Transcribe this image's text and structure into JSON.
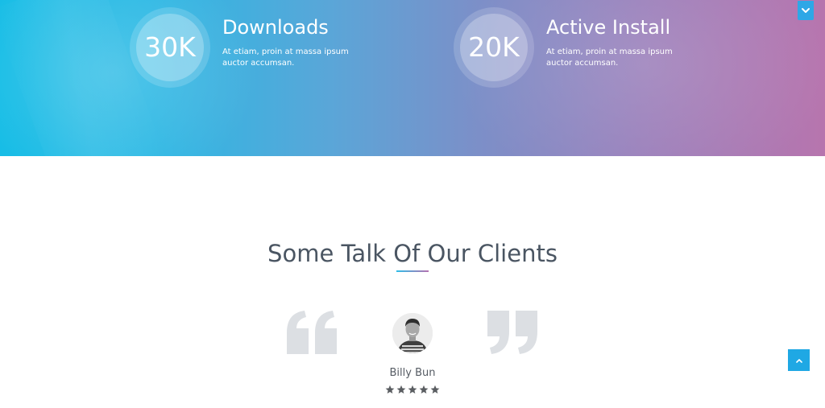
{
  "stats": [
    {
      "value": "30K",
      "title": "Downloads",
      "description": "At etiam, proin at massa ipsum auctor accumsan."
    },
    {
      "value": "20K",
      "title": "Active Install",
      "description": "At etiam, proin at massa ipsum auctor accumsan."
    }
  ],
  "testimonials": {
    "heading": "Some Talk Of Our Clients",
    "client_name": "Billy Bun",
    "rating": 5,
    "quote_color": "#dcdfe3"
  },
  "controls": {
    "dropdown_icon": "chevron-down-icon",
    "scroll_top_icon": "chevron-up-icon"
  },
  "colors": {
    "gradient_start": "#17bde6",
    "gradient_end": "#b775ae",
    "accent": "#1fa8e4",
    "heading_text": "#4a5562"
  }
}
